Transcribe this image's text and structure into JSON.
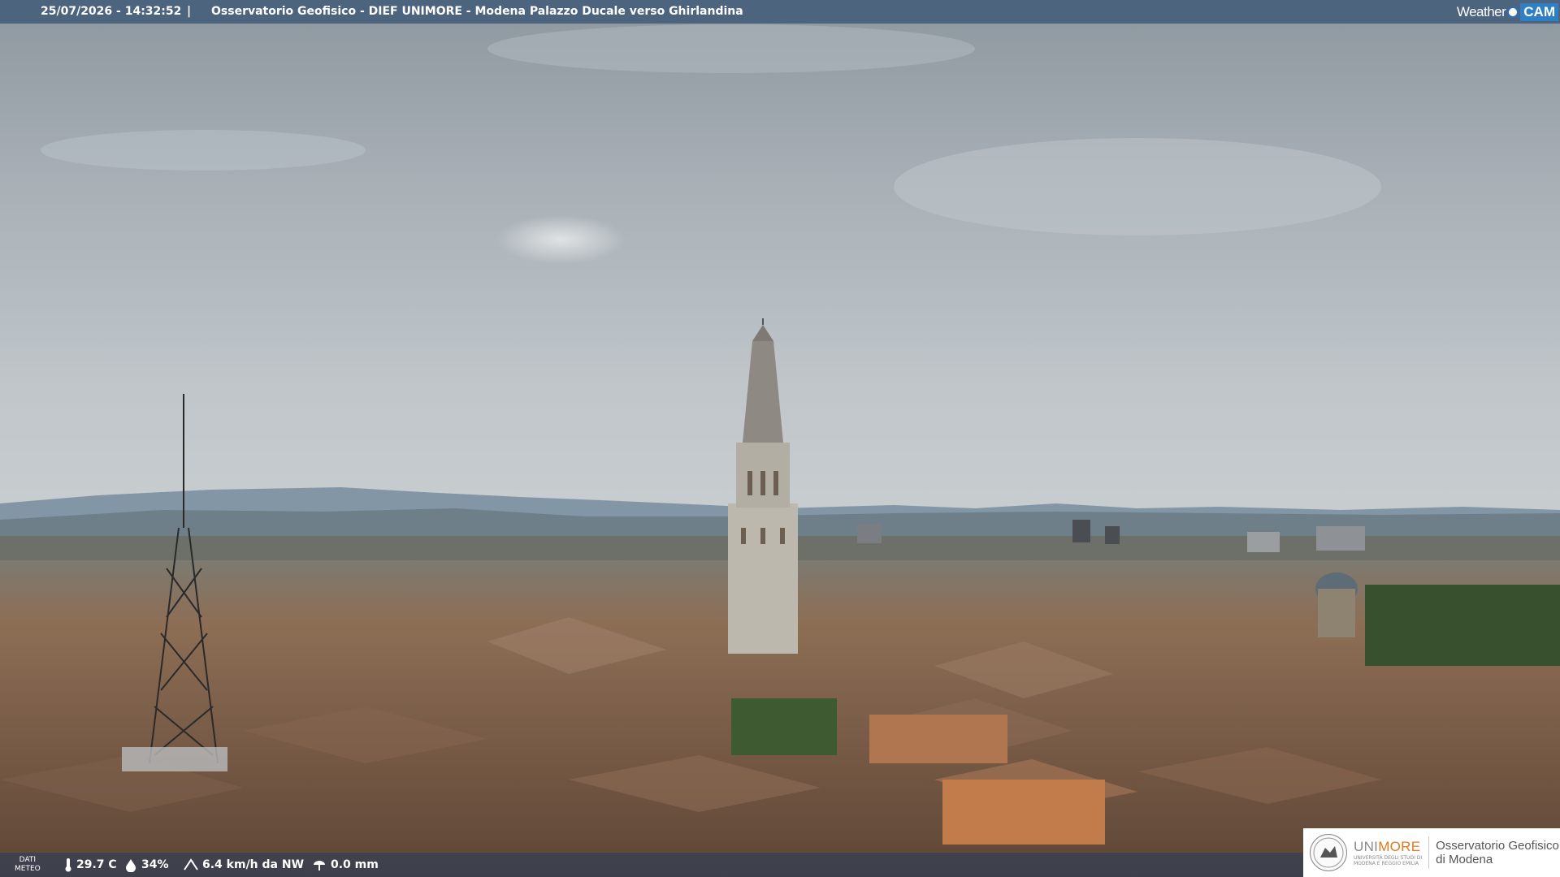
{
  "header": {
    "timestamp": "25/07/2026 - 14:32:52",
    "separator": "|",
    "title": "Osservatorio Geofisico - DIEF UNIMORE - Modena Palazzo Ducale verso Ghirlandina",
    "brand_weather": "Weather",
    "brand_cam": "CAM"
  },
  "weather": {
    "label_line1": "DATI",
    "label_line2": "METEO",
    "temperature": "29.7 C",
    "humidity": "34%",
    "wind": "6.4 km/h da NW",
    "rain": "0.0 mm",
    "icons": [
      "thermometer-icon",
      "humidity-drop-icon",
      "wind-icon",
      "rain-gauge-icon"
    ]
  },
  "logo": {
    "unimore_prefix": "UNI",
    "unimore_suffix": "MORE",
    "unimore_sub_1": "UNIVERSITÀ DEGLI STUDI DI",
    "unimore_sub_2": "MODENA E REGGIO EMILIA",
    "obs_line1": "Osservatorio Geofisico",
    "obs_line2": "di Modena"
  },
  "colors": {
    "header_bar": "#48607c",
    "brand_accent": "#2f7fc4",
    "unimore_orange": "#e07b1f"
  }
}
